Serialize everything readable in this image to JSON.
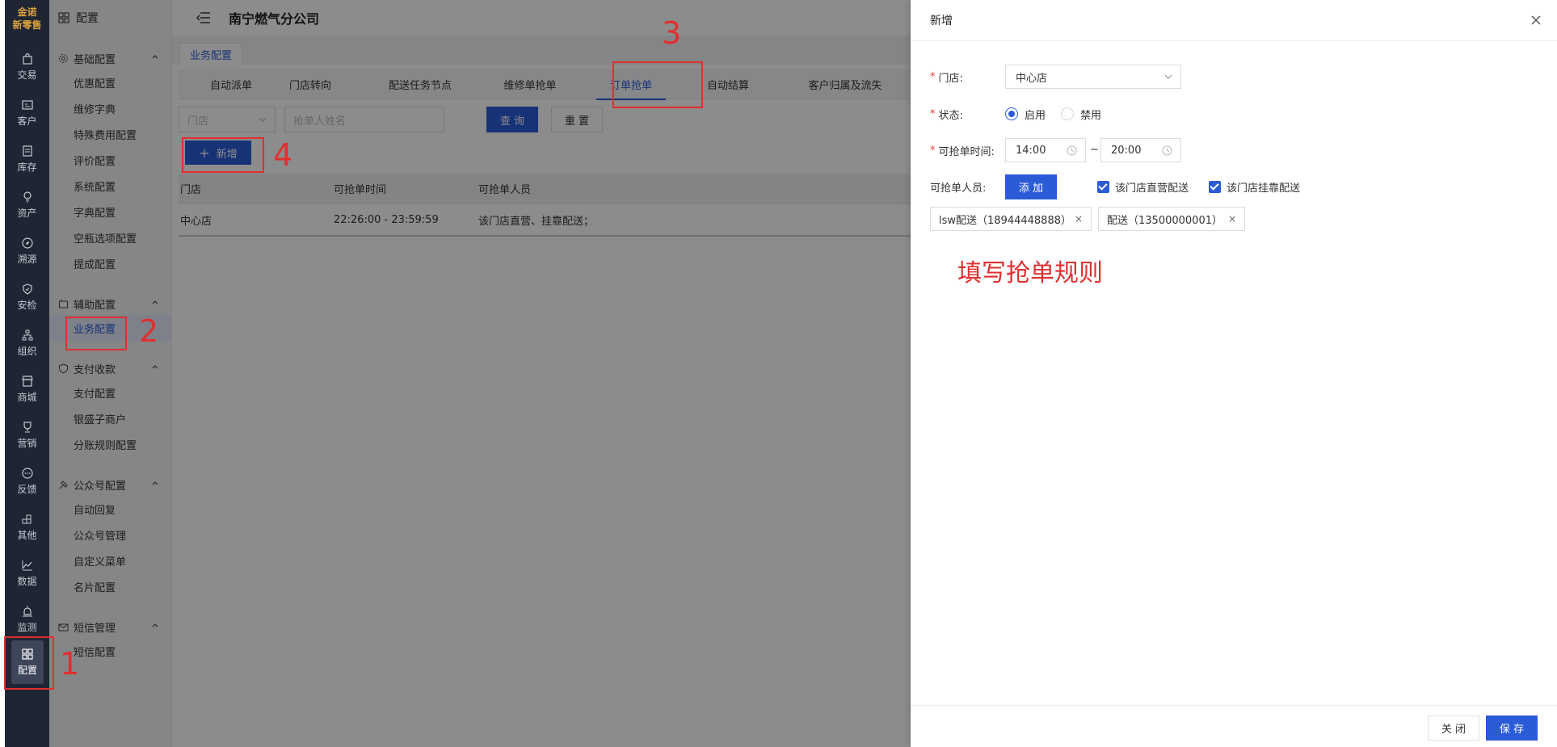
{
  "rail": {
    "logo_top": "金诺",
    "logo_bottom": "新零售",
    "items": [
      {
        "label": "交易",
        "icon": "shopping-bag-icon"
      },
      {
        "label": "客户",
        "icon": "id-card-icon"
      },
      {
        "label": "库存",
        "icon": "clipboard-icon"
      },
      {
        "label": "资产",
        "icon": "lightbulb-icon"
      },
      {
        "label": "溯源",
        "icon": "compass-icon"
      },
      {
        "label": "安检",
        "icon": "shield-check-icon"
      },
      {
        "label": "组织",
        "icon": "org-chart-icon"
      },
      {
        "label": "商城",
        "icon": "store-icon"
      },
      {
        "label": "营销",
        "icon": "trophy-icon"
      },
      {
        "label": "反馈",
        "icon": "chat-bubble-icon"
      },
      {
        "label": "其他",
        "icon": "blocks-icon"
      },
      {
        "label": "数据",
        "icon": "line-chart-icon"
      },
      {
        "label": "监测",
        "icon": "alarm-icon"
      },
      {
        "label": "配置",
        "icon": "grid-icon"
      }
    ]
  },
  "submenu": {
    "title": "配置",
    "groups": [
      {
        "label": "基础配置",
        "items": [
          "优惠配置",
          "维修字典",
          "特殊费用配置",
          "评价配置",
          "系统配置",
          "字典配置",
          "空瓶选项配置",
          "提成配置"
        ]
      },
      {
        "label": "辅助配置",
        "items": [
          "业务配置"
        ]
      },
      {
        "label": "支付收款",
        "items": [
          "支付配置",
          "银盛子商户",
          "分账规则配置"
        ]
      },
      {
        "label": "公众号配置",
        "items": [
          "自动回复",
          "公众号管理",
          "自定义菜单",
          "名片配置"
        ]
      },
      {
        "label": "短信管理",
        "items": [
          "短信配置"
        ]
      }
    ]
  },
  "header": {
    "company": "南宁燃气分公司"
  },
  "breadcrumb": {
    "tab": "业务配置"
  },
  "tabs": [
    "自动派单",
    "门店转向",
    "配送任务节点",
    "维修单抢单",
    "订单抢单",
    "自动结算",
    "客户归属及流失"
  ],
  "filters": {
    "store_placeholder": "门店",
    "name_placeholder": "抢单人姓名",
    "query": "查 询",
    "reset": "重 置",
    "add": "新增",
    "add_prefix": "+"
  },
  "table": {
    "columns": [
      "门店",
      "可抢单时间",
      "可抢单人员"
    ],
    "rows": [
      [
        "中心店",
        "22:26:00 - 23:59:59",
        "该门店直营、挂靠配送；"
      ]
    ]
  },
  "drawer": {
    "title": "新增",
    "store_label": "门店:",
    "store_value": "中心店",
    "status_label": "状态:",
    "status_on": "启用",
    "status_off": "禁用",
    "time_label": "可抢单时间:",
    "time_start": "14:00",
    "time_sep": "~",
    "time_end": "20:00",
    "staff_label": "可抢单人员:",
    "add_btn": "添 加",
    "chk_direct": "该门店直营配送",
    "chk_affiliated": "该门店挂靠配送",
    "tags": [
      "lsw配送（18944448888）",
      "配送（13500000001）"
    ],
    "tag_close": "×",
    "annotation": "填写抢单规则",
    "close_btn": "关 闭",
    "save_btn": "保 存"
  },
  "annotations": {
    "n1": "1",
    "n2": "2",
    "n3": "3",
    "n4": "4"
  },
  "colors": {
    "primary": "#2b5bd7",
    "annotation_red": "#e02f2f",
    "rail_bg": "#1f2533"
  }
}
